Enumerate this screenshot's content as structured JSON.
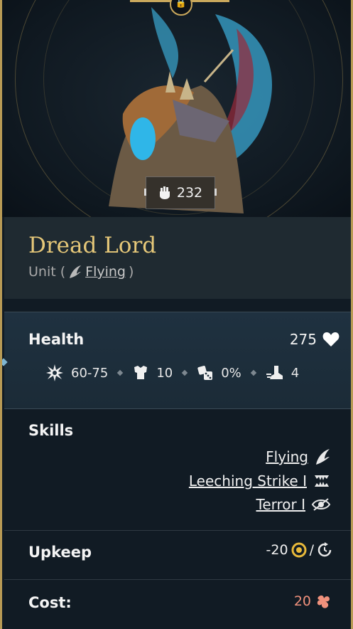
{
  "unit": {
    "name": "Dread Lord",
    "type_prefix": "Unit (",
    "type_tag": "Flying",
    "type_suffix": ")",
    "power": "232"
  },
  "stats": {
    "health_label": "Health",
    "health_value": "275",
    "damage": "60-75",
    "defense": "10",
    "chance": "0%",
    "movement": "4"
  },
  "skills": {
    "label": "Skills",
    "items": [
      "Flying",
      "Leeching Strike I",
      "Terror I"
    ]
  },
  "upkeep": {
    "label": "Upkeep",
    "value": "-20",
    "separator": "/"
  },
  "cost": {
    "label": "Cost:",
    "value": "20"
  },
  "colors": {
    "gold": "#e6c879",
    "cost": "#f0917c",
    "frame": "#b89a55"
  },
  "icons": {
    "lock": "lock-icon",
    "power": "fist-icon",
    "flying": "wing-icon",
    "health": "heart-icon",
    "damage": "burst-icon",
    "defense": "armor-icon",
    "chance": "dice-icon",
    "movement": "boot-icon",
    "leech": "fangs-icon",
    "terror": "eye-icon",
    "gold": "gold-coin-icon",
    "turn": "turn-icon",
    "cost": "resource-icon"
  }
}
